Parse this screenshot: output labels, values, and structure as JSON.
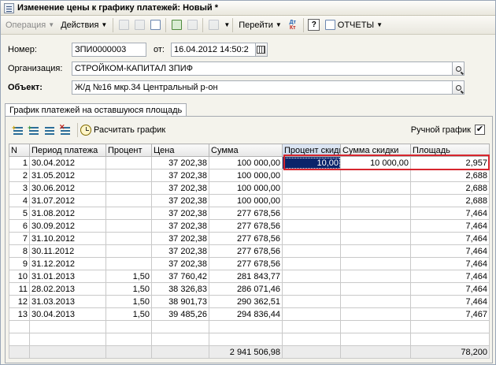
{
  "window": {
    "title": "Изменение цены к графику платежей: Новый *"
  },
  "toolbar": {
    "operation_label": "Операция",
    "actions_label": "Действия",
    "goto_label": "Перейти",
    "help_label": "?",
    "reports_label": "ОТЧЕТЫ",
    "dtkt_top": "Дт",
    "dtkt_bottom": "Кт"
  },
  "form": {
    "number_label": "Номер:",
    "number_value": "ЗПИ0000003",
    "date_label": "от:",
    "date_value": "16.04.2012 14:50:2",
    "org_label": "Организация:",
    "org_value": "СТРОЙКОМ-КАПИТАЛ ЗПИФ",
    "object_label": "Объект:",
    "object_value": "Ж/д №16 мкр.34 Центральный р-он"
  },
  "tab": {
    "label": "График платежей на оставшуюся площадь"
  },
  "panel": {
    "calc_label": "Расчитать график",
    "manual_label": "Ручной график",
    "manual_checked": "✔"
  },
  "table": {
    "columns": [
      "N",
      "Период платежа",
      "Процент",
      "Цена",
      "Сумма",
      "Процент скидки",
      "Сумма скидки",
      "Площадь"
    ],
    "rows": [
      [
        "1",
        "30.04.2012",
        "",
        "37 202,38",
        "100 000,00",
        "10,00",
        "10 000,00",
        "2,957"
      ],
      [
        "2",
        "31.05.2012",
        "",
        "37 202,38",
        "100 000,00",
        "",
        "",
        "2,688"
      ],
      [
        "3",
        "30.06.2012",
        "",
        "37 202,38",
        "100 000,00",
        "",
        "",
        "2,688"
      ],
      [
        "4",
        "31.07.2012",
        "",
        "37 202,38",
        "100 000,00",
        "",
        "",
        "2,688"
      ],
      [
        "5",
        "31.08.2012",
        "",
        "37 202,38",
        "277 678,56",
        "",
        "",
        "7,464"
      ],
      [
        "6",
        "30.09.2012",
        "",
        "37 202,38",
        "277 678,56",
        "",
        "",
        "7,464"
      ],
      [
        "7",
        "31.10.2012",
        "",
        "37 202,38",
        "277 678,56",
        "",
        "",
        "7,464"
      ],
      [
        "8",
        "30.11.2012",
        "",
        "37 202,38",
        "277 678,56",
        "",
        "",
        "7,464"
      ],
      [
        "9",
        "31.12.2012",
        "",
        "37 202,38",
        "277 678,56",
        "",
        "",
        "7,464"
      ],
      [
        "10",
        "31.01.2013",
        "1,50",
        "37 760,42",
        "281 843,77",
        "",
        "",
        "7,464"
      ],
      [
        "11",
        "28.02.2013",
        "1,50",
        "38 326,83",
        "286 071,46",
        "",
        "",
        "7,464"
      ],
      [
        "12",
        "31.03.2013",
        "1,50",
        "38 901,73",
        "290 362,51",
        "",
        "",
        "7,464"
      ],
      [
        "13",
        "30.04.2013",
        "1,50",
        "39 485,26",
        "294 836,44",
        "",
        "",
        "7,467"
      ]
    ],
    "footer": [
      "",
      "",
      "",
      "",
      "2 941 506,98",
      "",
      "",
      "78,200"
    ]
  },
  "colors": {
    "selection": "#0a246a",
    "highlight": "#d7262e"
  }
}
